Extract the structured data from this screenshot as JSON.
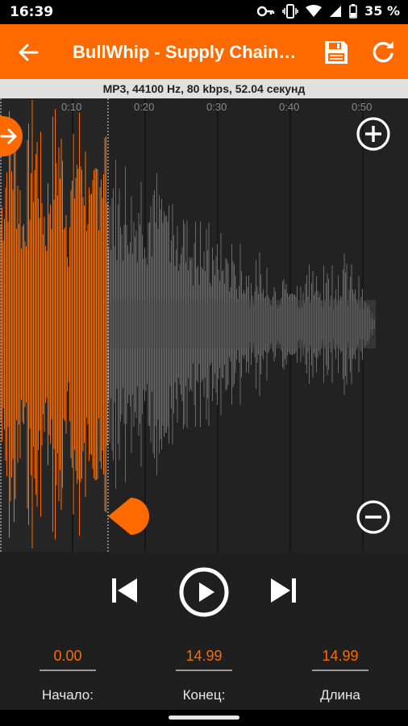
{
  "status_bar": {
    "time": "16:39",
    "battery_percent": "35 %",
    "icons": [
      "key-icon",
      "vibrate-icon",
      "wifi-icon",
      "signal-icon",
      "battery-icon"
    ]
  },
  "app_bar": {
    "title": "BullWhip - Supply Chain…",
    "back_icon": "arrow-back-icon",
    "save_icon": "save-icon",
    "reset_icon": "reset-icon"
  },
  "info": {
    "text": "MP3, 44100 Hz, 80 kbps, 52.04 секунд"
  },
  "waveform": {
    "time_ticks": [
      "0:10",
      "0:20",
      "0:30",
      "0:40",
      "0:50"
    ],
    "zoom_in_icon": "zoom-in-icon",
    "zoom_out_icon": "zoom-out-icon",
    "start_marker_icon": "arrow-right-icon",
    "colors": {
      "selected": "#ff6a00",
      "unselected": "#6a6a6a",
      "background": "#222222"
    }
  },
  "controls": {
    "prev_icon": "skip-previous-icon",
    "play_icon": "play-icon",
    "next_icon": "skip-next-icon",
    "start_value": "0.00",
    "end_value": "14.99",
    "length_value": "14.99",
    "start_label": "Начало:",
    "end_label": "Конец:",
    "length_label": "Длина"
  }
}
